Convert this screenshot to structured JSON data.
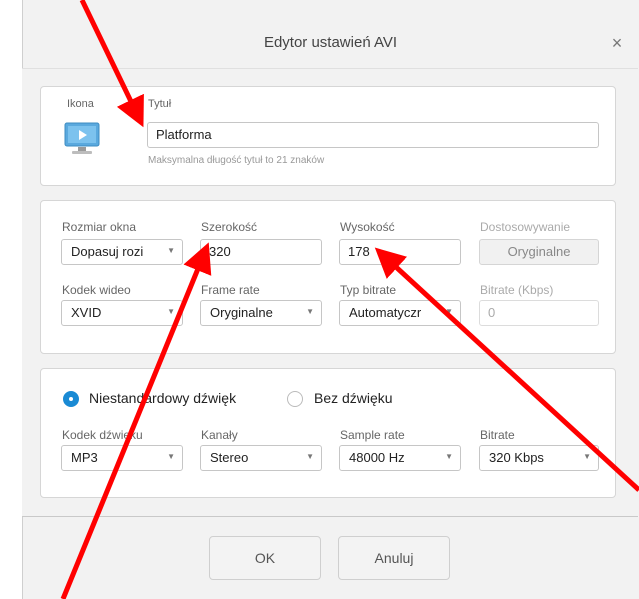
{
  "dialog": {
    "title": "Edytor ustawień AVI",
    "close_label": "×"
  },
  "header": {
    "icon_label": "Ikona",
    "title_label": "Tytuł",
    "title_value": "Platforma",
    "title_hint": "Maksymalna długość tytuł to 21 znaków",
    "icon": "monitor-play-icon"
  },
  "video": {
    "window_size_label": "Rozmiar okna",
    "window_size_value": "Dopasuj rozi",
    "width_label": "Szerokość",
    "width_value": "320",
    "height_label": "Wysokość",
    "height_value": "178",
    "adjust_label": "Dostosowywanie",
    "adjust_value": "Oryginalne",
    "codec_label": "Kodek wideo",
    "codec_value": "XVID",
    "framerate_label": "Frame rate",
    "framerate_value": "Oryginalne",
    "bitrate_type_label": "Typ bitrate",
    "bitrate_type_value": "Automatyczr",
    "bitrate_label": "Bitrate (Kbps)",
    "bitrate_value": "0"
  },
  "audio": {
    "radio_standard": "Niestandardowy dźwięk",
    "radio_none": "Bez dźwięku",
    "selected": "standard",
    "codec_label": "Kodek dźwięku",
    "codec_value": "MP3",
    "channels_label": "Kanały",
    "channels_value": "Stereo",
    "sample_rate_label": "Sample rate",
    "sample_rate_value": "48000 Hz",
    "bitrate_label": "Bitrate",
    "bitrate_value": "320 Kbps"
  },
  "footer": {
    "ok_label": "OK",
    "cancel_label": "Anuluj"
  },
  "colors": {
    "accent": "#1a8ad4",
    "annotation_arrow": "#ff0000"
  }
}
